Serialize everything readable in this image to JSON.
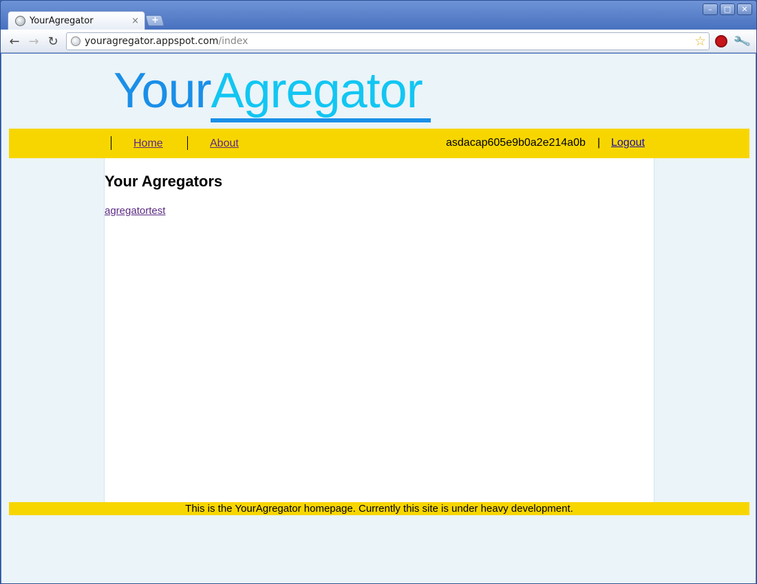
{
  "browser": {
    "tab_title": "YourAgregator",
    "tab_close": "×",
    "new_tab": "+",
    "url_host": "youragregator.appspot.com",
    "url_path": "/index",
    "window_controls": {
      "minimize": "–",
      "maximize": "□",
      "close": "✕"
    },
    "icons": {
      "back": "←",
      "forward": "→",
      "reload": "↻",
      "star": "☆",
      "stop": "✋",
      "wrench": "🔧"
    }
  },
  "page": {
    "logo": {
      "part1": "Your",
      "part2": "Agregator"
    },
    "nav": {
      "home": "Home",
      "about": "About",
      "username": "asdacap605e9b0a2e214a0b",
      "separator": "|",
      "logout": "Logout"
    },
    "heading": "Your Agregators",
    "agregators": [
      "agregatortest"
    ],
    "footer": "This is the YourAgregator homepage. Currently this site is under heavy development."
  },
  "colors": {
    "logo_your": "#1a8fe8",
    "logo_agg": "#13c6f2",
    "navbar_bg": "#f7d600",
    "page_bg": "#ebf4f8",
    "link_visited": "#5b2a82",
    "link": "#1a0dab"
  }
}
